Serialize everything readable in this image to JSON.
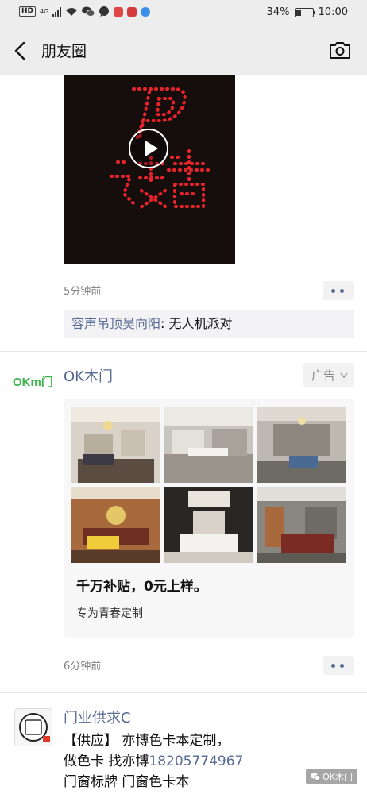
{
  "status_bar": {
    "hd": "HD",
    "network": "4G",
    "battery": "34%",
    "battery_level": 0.34,
    "time": "10:00"
  },
  "nav": {
    "title": "朋友圈",
    "back_icon": "chevron-left-icon",
    "camera_icon": "camera-icon"
  },
  "post1": {
    "video_icon": "play-icon",
    "time": "5分钟前",
    "comment_author": "容声吊顶吴向阳",
    "comment_text": ": 无人机派对"
  },
  "ad": {
    "logo_text": "OKm门",
    "name": "OK木门",
    "badge": "广告",
    "headline": "千万补贴，0元上样。",
    "sub": "专为青春定制",
    "time": "6分钟前"
  },
  "post2": {
    "name": "门业供求C",
    "line1": "【供应】 亦博色卡本定制，",
    "line2_prefix": "做色卡 找亦博",
    "phone": "18205774967",
    "line3": "门窗标牌 门窗色卡本"
  },
  "watermark": "OK木门",
  "colors": {
    "link": "#576b95",
    "nav_bg": "#ededed",
    "ad_logo": "#3bb54a"
  }
}
